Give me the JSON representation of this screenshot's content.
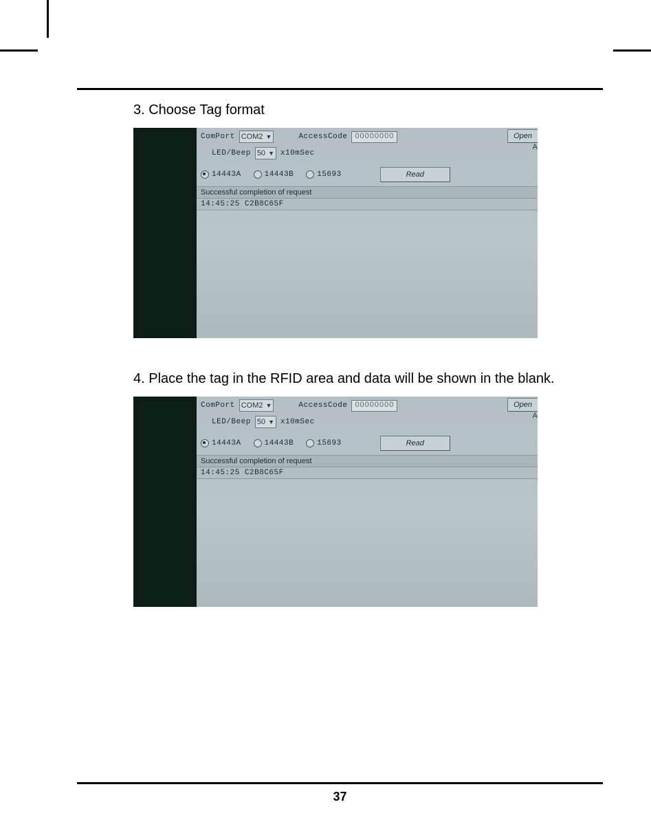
{
  "step3": {
    "caption": "3. Choose Tag format"
  },
  "step4": {
    "caption": "4. Place the tag in the RFID area and data will be shown in the blank."
  },
  "ui": {
    "comport_label": "ComPort",
    "comport_value": "COM2",
    "accesscode_label": "AccessCode",
    "accesscode_value": "00000000",
    "open_button": "Open",
    "ledbeep_label": "LED/Beep",
    "ledbeep_value": "50",
    "ledbeep_unit": "x10mSec",
    "radio_14443a": "14443A",
    "radio_14443b": "14443B",
    "radio_15693": "15693",
    "read_button": "Read",
    "status_text": "Successful completion of request",
    "result_text": "14:45:25  C2B8C65F",
    "corner_a": "A"
  },
  "page_number": "37"
}
